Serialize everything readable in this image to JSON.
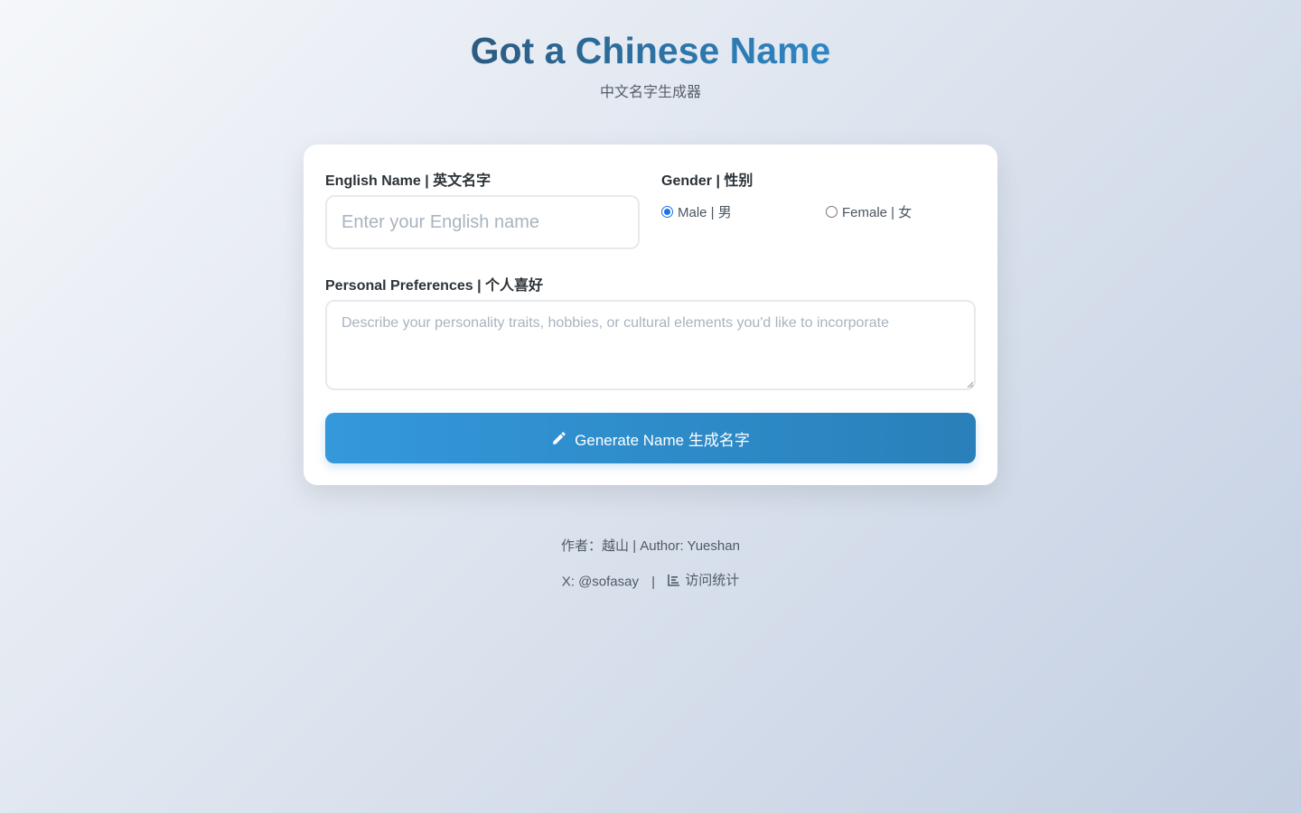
{
  "header": {
    "title": "Got a Chinese Name",
    "subtitle": "中文名字生成器"
  },
  "form": {
    "english_name_label": "English Name | 英文名字",
    "english_name_placeholder": "Enter your English name",
    "english_name_value": "",
    "gender_label": "Gender | 性别",
    "gender_options": [
      "Male | 男",
      "Female | 女"
    ],
    "gender_selected": "Male | 男",
    "preferences_label": "Personal Preferences | 个人喜好",
    "preferences_placeholder": "Describe your personality traits, hobbies, or cultural elements you'd like to incorporate",
    "preferences_value": "",
    "generate_button_label": "Generate Name 生成名字",
    "generate_button_icon": "pencil-icon"
  },
  "footer": {
    "author": "作者：越山 | Author: Yueshan",
    "x_link": "X: @sofasay",
    "separator": "|",
    "stats_link": "访问统计",
    "stats_icon": "bar-chart-icon"
  },
  "colors": {
    "accent": "#3498db",
    "accent_dark": "#2980b9",
    "title_start": "#2c5b80",
    "title_end": "#2f86c4",
    "radio_selected": "#1a73e8"
  }
}
